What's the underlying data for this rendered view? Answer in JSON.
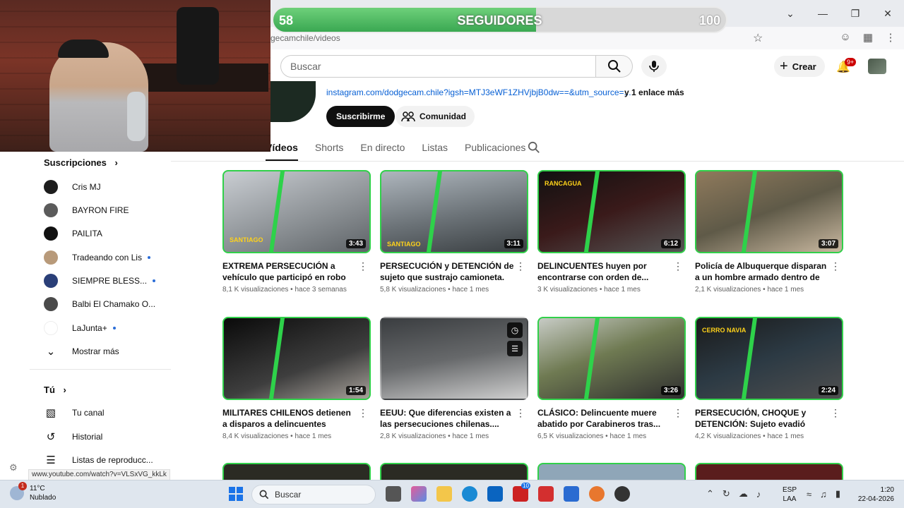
{
  "browser": {
    "url": "gecamchile/videos",
    "status_url": "www.youtube.com/watch?v=VLSxVG_kkLk"
  },
  "followers": {
    "current": "58",
    "label": "SEGUIDORES",
    "goal": "100",
    "progress_fraction": 0.58
  },
  "header": {
    "search_placeholder": "Buscar",
    "create_label": "Crear",
    "notifications_badge": "9+"
  },
  "channel": {
    "link": "instagram.com/dodgecam.chile?igsh=MTJ3eWF1ZHVjbjB0dw==&utm_source=...",
    "more_links": "y 1 enlace más",
    "subscribe_label": "Suscribirme",
    "community_label": "Comunidad"
  },
  "tabs": [
    "Vídeos",
    "Shorts",
    "En directo",
    "Listas",
    "Publicaciones"
  ],
  "sidebar": {
    "subscriptions_title": "Suscripciones",
    "subscriptions": [
      {
        "name": "Cris MJ",
        "dot": false
      },
      {
        "name": "BAYRON FIRE",
        "dot": false
      },
      {
        "name": "PAILITA",
        "dot": false
      },
      {
        "name": "Tradeando con Lis",
        "dot": true
      },
      {
        "name": "SIEMPRE BLESS...",
        "dot": true
      },
      {
        "name": "Balbi El Chamako O...",
        "dot": false
      },
      {
        "name": "LaJunta+",
        "dot": true
      }
    ],
    "show_more": "Mostrar más",
    "you_title": "Tú",
    "you_items": [
      "Tu canal",
      "Historial",
      "Listas de reproducc..."
    ]
  },
  "videos": [
    {
      "title": "EXTREMA PERSECUCIÓN a vehículo que participó en robo de camión.",
      "views": "8,1 K visualizaciones",
      "age": "hace 3 semanas",
      "duration": "3:43",
      "tag": "SANTIAGO"
    },
    {
      "title": "PERSECUCIÓN y DETENCIÓN de sujeto que sustrajo camioneta.",
      "views": "5,8 K visualizaciones",
      "age": "hace 1 mes",
      "duration": "3:11",
      "tag": "SANTIAGO"
    },
    {
      "title": "DELINCUENTES huyen por encontrarse con orden de...",
      "views": "3 K visualizaciones",
      "age": "hace 1 mes",
      "duration": "6:12",
      "tag": "RANCAGUA"
    },
    {
      "title": "Policía de Albuquerque disparan a un hombre armado dentro de un...",
      "views": "2,1 K visualizaciones",
      "age": "hace 1 mes",
      "duration": "3:07",
      "tag": ""
    },
    {
      "title": "MILITARES CHILENOS detienen a disparos a delincuentes bolivianos...",
      "views": "8,4 K visualizaciones",
      "age": "hace 1 mes",
      "duration": "1:54",
      "tag": ""
    },
    {
      "title": "EEUU: Que diferencias existen a las persecuciones chilenas....",
      "views": "2,8 K visualizaciones",
      "age": "hace 1 mes",
      "duration": "",
      "tag": ""
    },
    {
      "title": "CLÁSICO: Delincuente muere abatido por Carabineros tras...",
      "views": "6,5 K visualizaciones",
      "age": "hace 1 mes",
      "duration": "3:26",
      "tag": ""
    },
    {
      "title": "PERSECUCIÓN, CHOQUE y DETENCIÓN: Sujeto evadió control...",
      "views": "4,2 K visualizaciones",
      "age": "hace 1 mes",
      "duration": "2:24",
      "tag": "CERRO NAVIA"
    }
  ],
  "meta_sep": "•",
  "taskbar": {
    "temperature": "11°C",
    "weather": "Nublado",
    "weather_badge": "1",
    "search_label": "Buscar",
    "app_badge": "10",
    "lang_top": "ESP",
    "lang_bottom": "LAA",
    "time": "1:20",
    "date": "22-04-2026"
  }
}
